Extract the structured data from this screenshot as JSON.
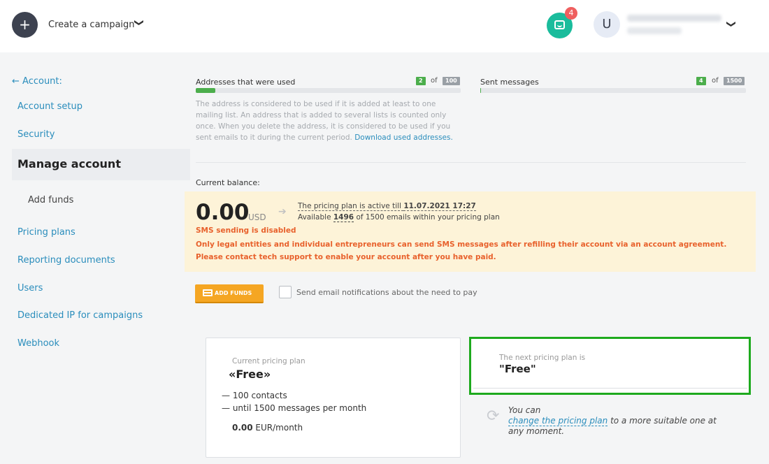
{
  "header": {
    "create_icon": "+",
    "create_label": "Create a campaign",
    "chevron": "❯",
    "chat_badge": "4",
    "avatar_letter": "U",
    "user_chevron": "❯"
  },
  "sidebar": {
    "back_label": "← Account:",
    "items": [
      {
        "label": "Account setup"
      },
      {
        "label": "Security"
      },
      {
        "label": "Manage account"
      },
      {
        "label": "Add funds"
      },
      {
        "label": "Pricing plans"
      },
      {
        "label": "Reporting documents"
      },
      {
        "label": "Users"
      },
      {
        "label": "Dedicated IP for campaigns"
      },
      {
        "label": "Webhook"
      }
    ]
  },
  "usage": {
    "addresses": {
      "label": "Addresses that were used",
      "used": "2",
      "of": "of",
      "total": "100",
      "fraction": 0.02
    },
    "messages": {
      "label": "Sent messages",
      "used": "4",
      "of": "of",
      "total": "1500",
      "fraction": 0.0027
    },
    "help_text": "The address is considered to be used if it is added at least to one mailing list. An address that is added to several lists is counted only once. When you delete the address, it is considered to be used if you sent emails to it during the current period. ",
    "help_link": "Download used addresses."
  },
  "balance": {
    "label": "Current balance:",
    "amount": "0.00",
    "currency": "USD",
    "arrow": "➔",
    "plan_active_prefix": "The pricing plan is active till ",
    "plan_active_date": "11.07.2021 17:27",
    "available_prefix": "Available ",
    "available_count": "1496",
    "available_suffix": " of 1500 emails within your pricing plan",
    "sms_title": "SMS sending is disabled",
    "sms_message": "Only legal entities and individual entrepreneurs can send SMS messages after refilling their account via an account agreement. Please contact tech support to enable your account after you have paid."
  },
  "actions": {
    "add_funds": "ADD FUNDS",
    "notify_label": "Send email notifications about the need to pay"
  },
  "current_plan": {
    "label": "Current pricing plan",
    "name": "«Free»",
    "features": [
      "— 100 contacts",
      "— until 1500 messages per month"
    ],
    "price": "0.00",
    "price_unit": " EUR/month"
  },
  "next_plan": {
    "label": "The next pricing plan is",
    "name": "\"Free\"",
    "refresh_icon": "⟳",
    "change_prefix": "You can ",
    "change_link": "change the pricing plan",
    "change_suffix": " to a more suitable one at any moment."
  },
  "colors": {
    "accent_link": "#2a8dbc",
    "success": "#4cae4c",
    "warning_text": "#e8612c",
    "notice_bg": "#fdf3d8",
    "button": "#f5a623",
    "highlight_border": "#1eaa1e"
  }
}
